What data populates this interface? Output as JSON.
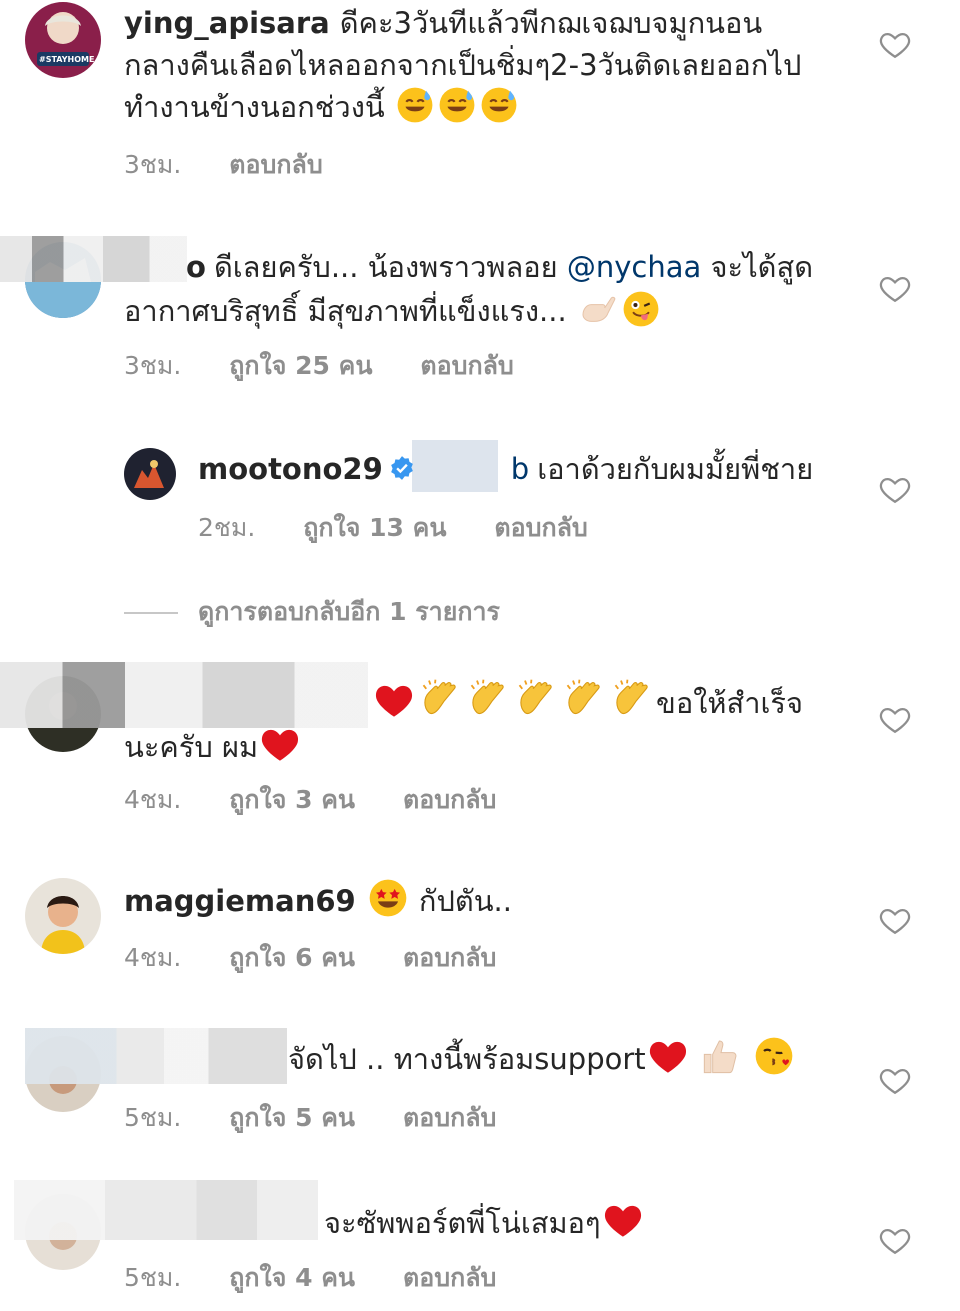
{
  "comments": [
    {
      "username": "ying_apisara",
      "text": "ดีคะ3วันทีแล้วพีกฌเจฌบจมูกนอนกลางคืนเลือดไหลออกจากเป็นชิ่มๆ2-3วันติดเลยออกไปทำงานข้างนอกช่วงนี้",
      "avatar_badge": "#STAYHOME",
      "time": "3ชม.",
      "reply": "ตอบกลับ"
    },
    {
      "username_suffix": "o",
      "text_before": "ดีเลยครับ... น้องพราวพลอย",
      "mention": "@nychaa",
      "text_after": "จะได้สูดอากาศบริสุทธิ์ มีสุขภาพที่แข็งแรง...",
      "time": "3ชม.",
      "likes": "ถูกใจ 25 คน",
      "reply": "ตอบกลับ"
    },
    {
      "username": "mootono29",
      "mention_suffix": "b",
      "text": "เอาด้วยกับผมมั้ยพี่ชาย",
      "time": "2ชม.",
      "likes": "ถูกใจ 13 คน",
      "reply": "ตอบกลับ"
    },
    {
      "text_mid": "ขอให้สำเร็จ",
      "text_end": "นะครับ ผม",
      "time": "4ชม.",
      "likes": "ถูกใจ 3 คน",
      "reply": "ตอบกลับ"
    },
    {
      "username": "maggieman69",
      "text": "กัปตัน..",
      "time": "4ชม.",
      "likes": "ถูกใจ 6 คน",
      "reply": "ตอบกลับ"
    },
    {
      "text": "จัดไป .. ทางนี้พร้อมsupport",
      "time": "5ชม.",
      "likes": "ถูกใจ 5 คน",
      "reply": "ตอบกลับ"
    },
    {
      "text": "จะซัพพอร์ตพี่โน่เสมอๆ",
      "time": "5ชม.",
      "likes": "ถูกใจ 4 คน",
      "reply": "ตอบกลับ"
    }
  ],
  "view_replies": "ดูการตอบกลับอีก 1 รายการ",
  "colors": {
    "mention": "#00376b",
    "meta": "#8e8e8e",
    "verified": "#3897f0",
    "heart": "#e0141e"
  },
  "icons": [
    "heart-outline-icon",
    "verified-badge-icon",
    "emoji-sweat-smile",
    "emoji-call-me-hand",
    "emoji-winking-tongue",
    "emoji-red-heart",
    "emoji-clapping-hands",
    "emoji-star-struck",
    "emoji-thumbs-up",
    "emoji-kissing-heart"
  ]
}
